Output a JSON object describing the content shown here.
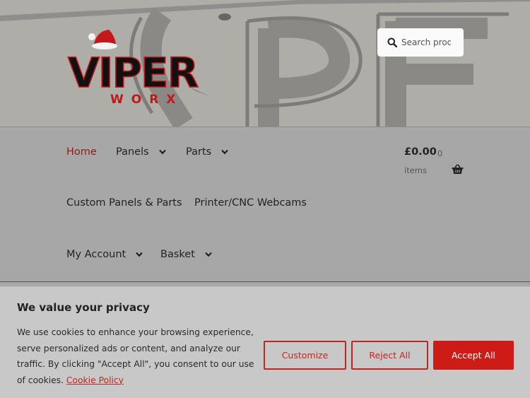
{
  "header": {
    "logo": {
      "main": "VIPER",
      "sub": "WORX"
    },
    "search": {
      "placeholder": "Search products…"
    }
  },
  "nav": {
    "items": [
      {
        "label": "Home",
        "active": true,
        "dropdown": false
      },
      {
        "label": "Panels",
        "dropdown": true
      },
      {
        "label": "Parts",
        "dropdown": true
      },
      {
        "label": "Custom Panels & Parts",
        "dropdown": false
      },
      {
        "label": "Printer/CNC Webcams",
        "dropdown": false
      },
      {
        "label": "My Account",
        "dropdown": true
      },
      {
        "label": "Basket",
        "dropdown": true
      }
    ],
    "cart": {
      "amount": "£0.00",
      "count": "0",
      "items_label": "items"
    }
  },
  "cookie_banner": {
    "title": "We value your privacy",
    "text": "We use cookies to enhance your browsing experience, serve personalized ads or content, and analyze our traffic. By clicking \"Accept All\", you consent to our use of cookies.",
    "policy_link": "Cookie Policy",
    "buttons": {
      "customize": "Customize",
      "reject": "Reject All",
      "accept": "Accept All"
    }
  },
  "colors": {
    "accent": "#c4261d",
    "nav_active": "#8a1f17",
    "banner_bg": "#a9a8a3"
  },
  "icons": [
    "search-icon",
    "chevron-down-icon",
    "basket-icon",
    "santa-hat-icon"
  ]
}
